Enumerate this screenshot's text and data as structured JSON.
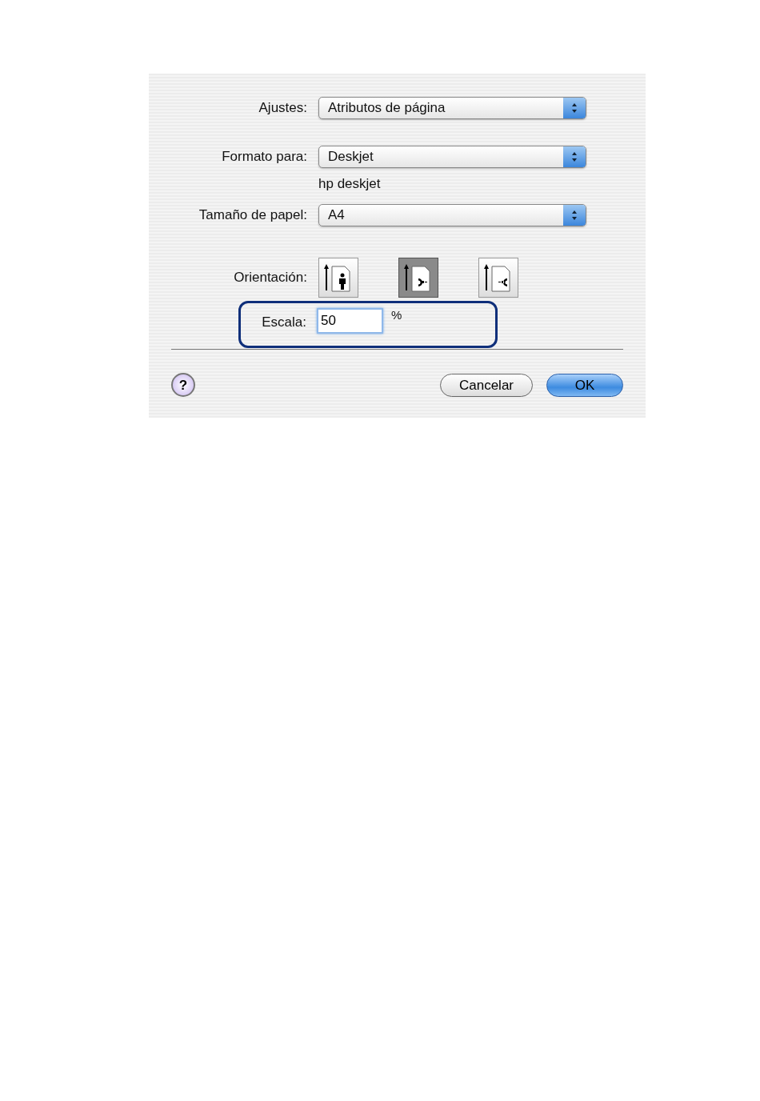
{
  "popups": [
    {
      "label": "Ajustes:",
      "value": "Atributos de página"
    },
    {
      "label": "Formato para:",
      "value": "Deskjet",
      "note": "hp deskjet"
    },
    {
      "label": "Tamaño de papel:",
      "value": "A4"
    }
  ],
  "orientation": {
    "label": "Orientación:",
    "options": [
      {
        "kind": "portrait",
        "selected": false
      },
      {
        "kind": "landscape",
        "selected": true
      },
      {
        "kind": "reverse-landscape",
        "selected": false
      }
    ]
  },
  "scale": {
    "label": "Escala:",
    "value": "50",
    "unit": "%",
    "highlighted": true
  },
  "help": "?",
  "buttons": [
    {
      "label": "Cancelar",
      "default": false
    },
    {
      "label": "OK",
      "default": true
    }
  ]
}
